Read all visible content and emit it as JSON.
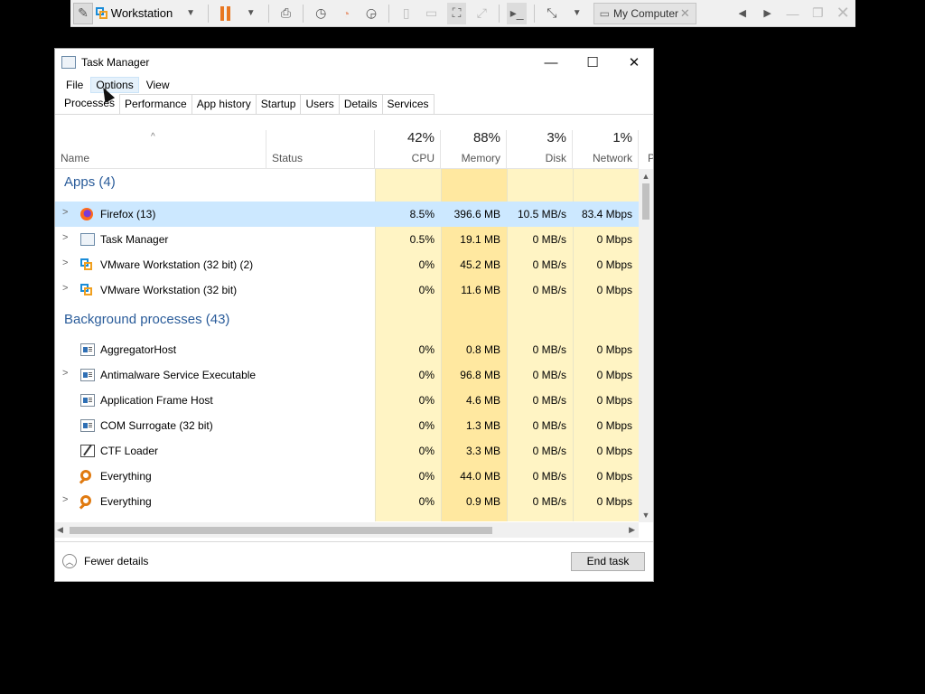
{
  "vmware_toolbar": {
    "library_name": "Workstation",
    "vm_tab_label": "My Computer"
  },
  "window": {
    "title": "Task Manager",
    "menu": [
      "File",
      "Options",
      "View"
    ],
    "tabs": [
      "Processes",
      "Performance",
      "App history",
      "Startup",
      "Users",
      "Details",
      "Services"
    ]
  },
  "columns": {
    "name": "Name",
    "status": "Status",
    "cpu": {
      "pct": "42%",
      "label": "CPU"
    },
    "memory": {
      "pct": "88%",
      "label": "Memory"
    },
    "disk": {
      "pct": "3%",
      "label": "Disk"
    },
    "network": {
      "pct": "1%",
      "label": "Network"
    },
    "overflow": "P"
  },
  "apps_group": "Apps (4)",
  "apps": [
    {
      "name": "Firefox (13)",
      "cpu": "8.5%",
      "memory": "396.6 MB",
      "disk": "10.5 MB/s",
      "network": "83.4 Mbps",
      "icon": "firefox-icon",
      "expandable": true,
      "selected": true
    },
    {
      "name": "Task Manager",
      "cpu": "0.5%",
      "memory": "19.1 MB",
      "disk": "0 MB/s",
      "network": "0 Mbps",
      "icon": "task-manager-icon",
      "expandable": true
    },
    {
      "name": "VMware Workstation (32 bit) (2)",
      "cpu": "0%",
      "memory": "45.2 MB",
      "disk": "0 MB/s",
      "network": "0 Mbps",
      "icon": "vmware-icon",
      "expandable": true
    },
    {
      "name": "VMware Workstation (32 bit)",
      "cpu": "0%",
      "memory": "11.6 MB",
      "disk": "0 MB/s",
      "network": "0 Mbps",
      "icon": "vmware-icon",
      "expandable": true
    }
  ],
  "bg_group": "Background processes (43)",
  "background": [
    {
      "name": "AggregatorHost",
      "cpu": "0%",
      "memory": "0.8 MB",
      "disk": "0 MB/s",
      "network": "0 Mbps",
      "icon": "service-icon",
      "expandable": false
    },
    {
      "name": "Antimalware Service Executable",
      "cpu": "0%",
      "memory": "96.8 MB",
      "disk": "0 MB/s",
      "network": "0 Mbps",
      "icon": "service-icon",
      "expandable": true
    },
    {
      "name": "Application Frame Host",
      "cpu": "0%",
      "memory": "4.6 MB",
      "disk": "0 MB/s",
      "network": "0 Mbps",
      "icon": "service-icon",
      "expandable": false
    },
    {
      "name": "COM Surrogate (32 bit)",
      "cpu": "0%",
      "memory": "1.3 MB",
      "disk": "0 MB/s",
      "network": "0 Mbps",
      "icon": "service-icon",
      "expandable": false
    },
    {
      "name": "CTF Loader",
      "cpu": "0%",
      "memory": "3.3 MB",
      "disk": "0 MB/s",
      "network": "0 Mbps",
      "icon": "ctf-loader-icon",
      "expandable": false
    },
    {
      "name": "Everything",
      "cpu": "0%",
      "memory": "44.0 MB",
      "disk": "0 MB/s",
      "network": "0 Mbps",
      "icon": "everything-icon",
      "expandable": false
    },
    {
      "name": "Everything",
      "cpu": "0%",
      "memory": "0.9 MB",
      "disk": "0 MB/s",
      "network": "0 Mbps",
      "icon": "everything-icon",
      "expandable": true
    }
  ],
  "footer": {
    "fewer_details": "Fewer details",
    "end_task": "End task"
  }
}
